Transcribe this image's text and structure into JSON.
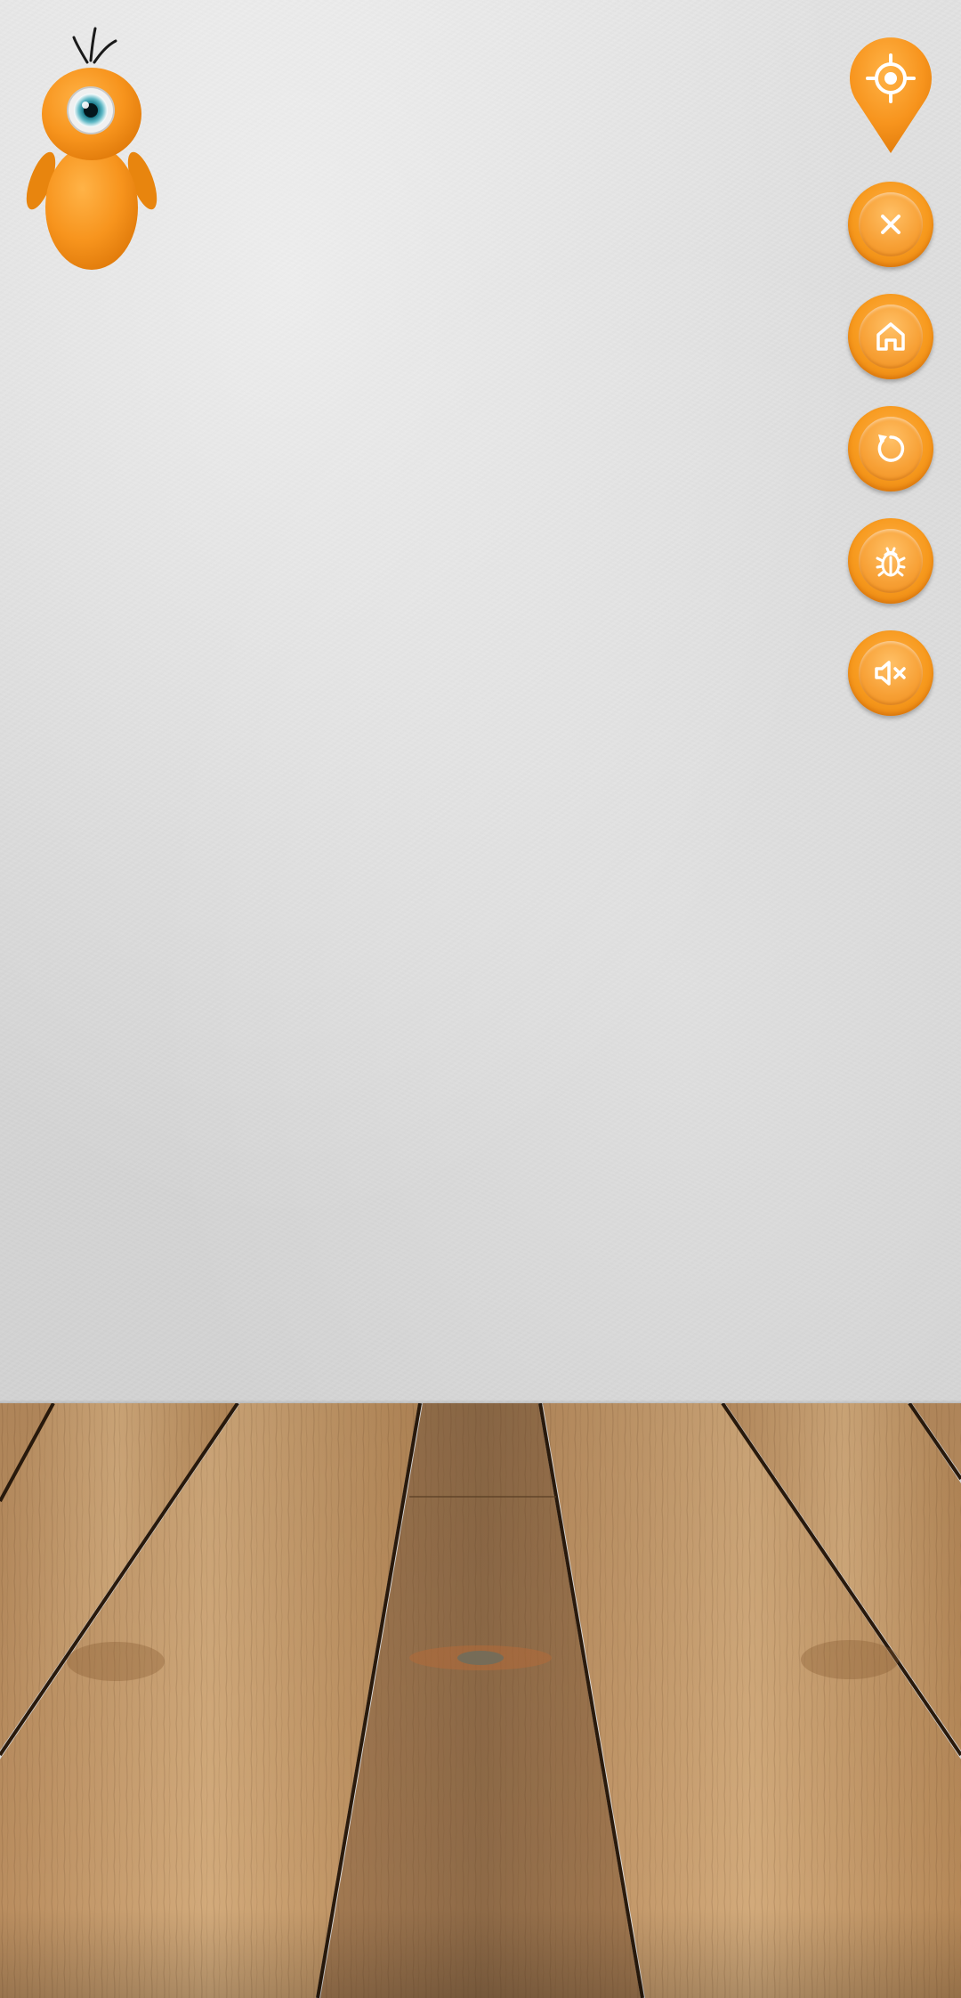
{
  "scene": {
    "background": "grey-paper-wall",
    "floor": "wooden-plank-table"
  },
  "mascot": {
    "icon": "orange-one-eyed-creature",
    "color": "#f7941d"
  },
  "controls": [
    {
      "id": "locate",
      "icon": "crosshair-pin-icon"
    },
    {
      "id": "close",
      "icon": "close-icon"
    },
    {
      "id": "home",
      "icon": "home-icon"
    },
    {
      "id": "restart",
      "icon": "restart-icon"
    },
    {
      "id": "bug",
      "icon": "bug-icon"
    },
    {
      "id": "mute",
      "icon": "speaker-mute-icon"
    }
  ],
  "colors": {
    "accent": "#f7941d",
    "accent_dark": "#e07a0a",
    "wood": "#c49868",
    "wall": "#dcdcdc"
  }
}
